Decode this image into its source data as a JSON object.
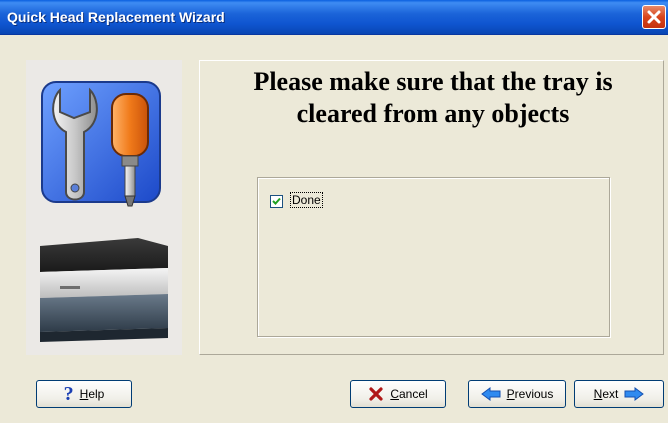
{
  "window": {
    "title": "Quick Head Replacement Wizard"
  },
  "heading": {
    "line1": "Please make sure that the tray is",
    "line2": "cleared from any objects"
  },
  "checkbox": {
    "label": "Done",
    "checked": true
  },
  "buttons": {
    "help_first": "H",
    "help_rest": "elp",
    "cancel_first": "C",
    "cancel_rest": "ancel",
    "previous_first": "P",
    "previous_rest": "revious",
    "next_first": "N",
    "next_rest": "ext"
  },
  "icons": {
    "close": "close-icon",
    "tools": "tools-icon",
    "printer": "printer-icon",
    "help": "question-mark-icon",
    "cancel": "x-icon",
    "previous": "arrow-left-icon",
    "next": "arrow-right-icon"
  },
  "colors": {
    "title_bar": "#0f55d0",
    "dialog_bg": "#ece9d8",
    "close_button": "#d8451c",
    "tool_orange": "#f07a1a",
    "tool_blue": "#3b73d6"
  }
}
